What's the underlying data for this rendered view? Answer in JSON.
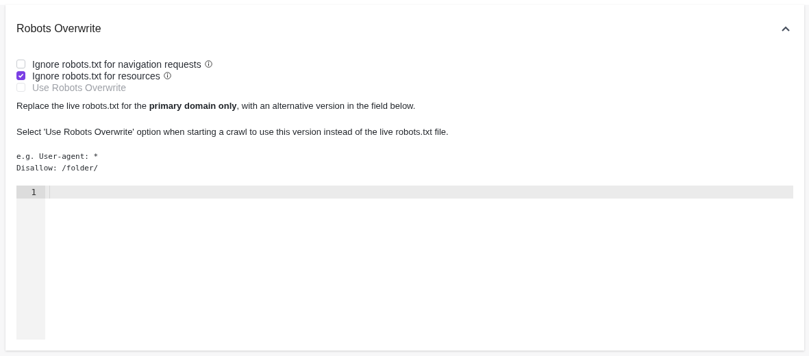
{
  "panel": {
    "title": "Robots Overwrite",
    "expanded": true
  },
  "options": [
    {
      "label": "Ignore robots.txt for navigation requests",
      "checked": false,
      "disabled": false,
      "info": true
    },
    {
      "label": "Ignore robots.txt for resources",
      "checked": true,
      "disabled": false,
      "info": true
    },
    {
      "label": "Use Robots Overwrite",
      "checked": false,
      "disabled": true,
      "info": false
    }
  ],
  "paragraphs": [
    "Replace the live robots.txt for the **primary domain only**, with an alternative version in the field below.",
    "Select 'Use Robots Overwrite' option when starting a crawl to use this version instead of the live robots.txt file."
  ],
  "example_lines": [
    "e.g. User-agent: *",
    "Disallow: /folder/"
  ],
  "editor": {
    "lines": [
      {
        "number": "1",
        "active": true
      }
    ]
  }
}
